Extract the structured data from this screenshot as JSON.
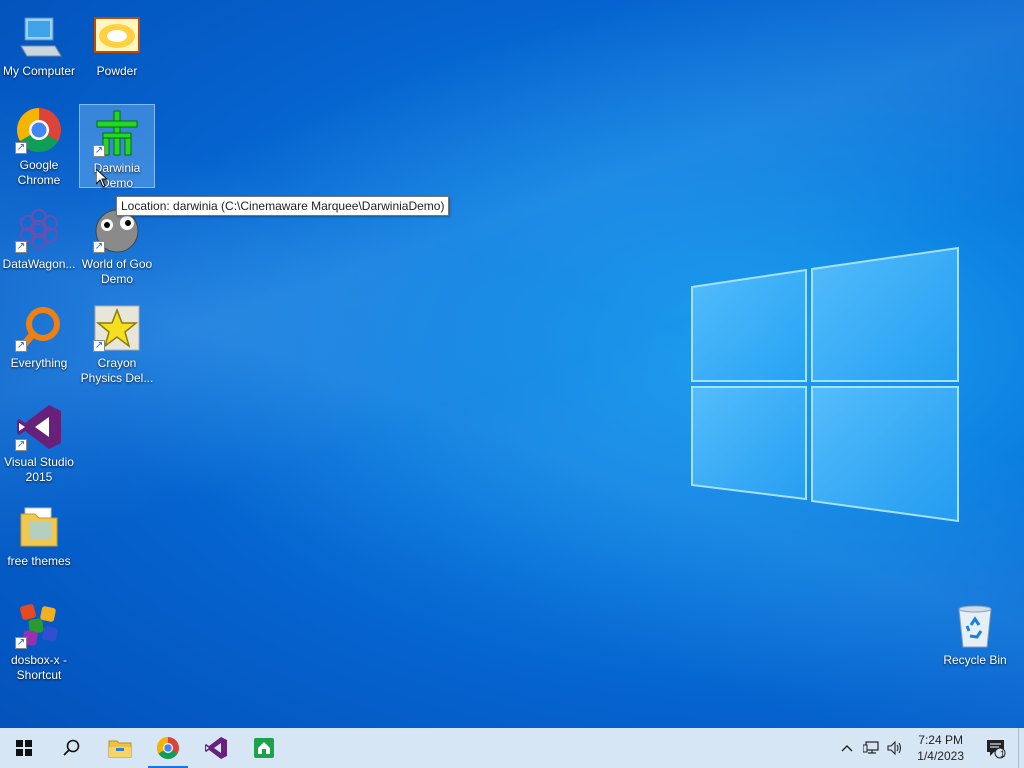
{
  "desktop": {
    "icons": [
      {
        "label": "My Computer",
        "icon": "computer-icon"
      },
      {
        "label": "Powder",
        "icon": "powder-icon"
      },
      {
        "label": "Google Chrome",
        "icon": "chrome-icon"
      },
      {
        "label": "Darwinia Demo",
        "icon": "darwinia-icon"
      },
      {
        "label": "DataWagon...",
        "icon": "datawagon-icon"
      },
      {
        "label": "World of Goo Demo",
        "icon": "world-of-goo-icon"
      },
      {
        "label": "Everything",
        "icon": "everything-icon"
      },
      {
        "label": "Crayon Physics Del...",
        "icon": "crayon-physics-icon"
      },
      {
        "label": "Visual Studio 2015",
        "icon": "visual-studio-icon"
      },
      {
        "label": "free themes",
        "icon": "folder-icon"
      },
      {
        "label": "dosbox-x - Shortcut",
        "icon": "dosbox-icon"
      },
      {
        "label": "Recycle Bin",
        "icon": "recycle-bin-icon"
      }
    ],
    "tooltip": "Location: darwinia (C:\\Cinemaware Marquee\\DarwiniaDemo)"
  },
  "taskbar": {
    "buttons": [
      "start-icon",
      "search-icon",
      "file-explorer-icon",
      "chrome-icon",
      "visual-studio-icon",
      "home-app-icon"
    ],
    "clock": {
      "time": "7:24 PM",
      "date": "1/4/2023"
    },
    "notification_count": "1"
  },
  "colors": {
    "accent": "#0563cf",
    "taskbar": "#d6e6f4"
  }
}
